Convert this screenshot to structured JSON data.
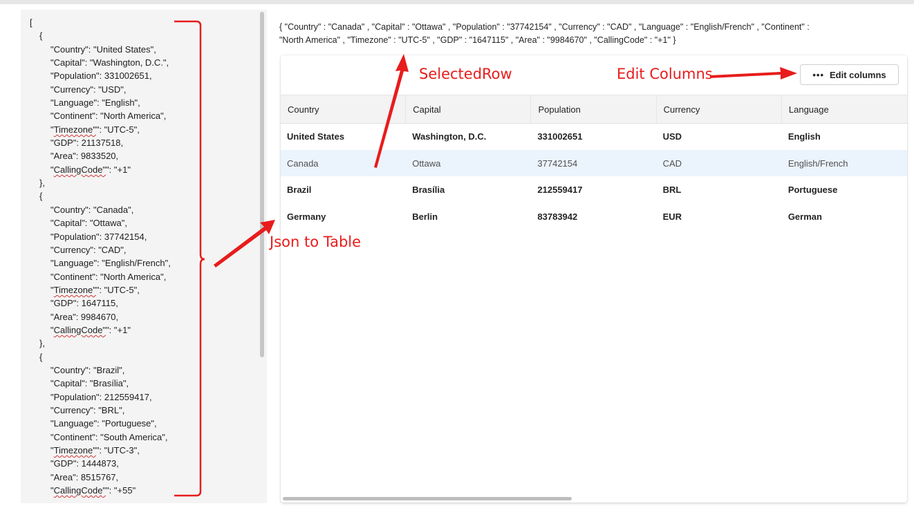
{
  "json_editor": {
    "lines": [
      "[",
      "{",
      "\"Country\": \"United States\",",
      "\"Capital\": \"Washington, D.C.\",",
      "\"Population\": 331002651,",
      "\"Currency\": \"USD\",",
      "\"Language\": \"English\",",
      "\"Continent\": \"North America\",",
      "\"Timezone\": \"UTC-5\",",
      "\"GDP\": 21137518,",
      "\"Area\": 9833520,",
      "\"CallingCode\": \"+1\"",
      "},",
      "{",
      "\"Country\": \"Canada\",",
      "\"Capital\": \"Ottawa\",",
      "\"Population\": 37742154,",
      "\"Currency\": \"CAD\",",
      "\"Language\": \"English/French\",",
      "\"Continent\": \"North America\",",
      "\"Timezone\": \"UTC-5\",",
      "\"GDP\": 1647115,",
      "\"Area\": 9984670,",
      "\"CallingCode\": \"+1\"",
      "},",
      "{",
      "\"Country\": \"Brazil\",",
      "\"Capital\": \"Brasília\",",
      "\"Population\": 212559417,",
      "\"Currency\": \"BRL\",",
      "\"Language\": \"Portuguese\",",
      "\"Continent\": \"South America\",",
      "\"Timezone\": \"UTC-3\",",
      "\"GDP\": 1444873,",
      "\"Area\": 8515767,",
      "\"CallingCode\": \"+55\""
    ]
  },
  "selected_row_text": "{  \"Country\" : \"Canada\" , \"Capital\" : \"Ottawa\" , \"Population\" : \"37742154\" , \"Currency\" : \"CAD\" , \"Language\" : \"English/French\" , \"Continent\" : \"North America\" , \"Timezone\" : \"UTC-5\" , \"GDP\" : \"1647115\" , \"Area\" : \"9984670\" , \"CallingCode\" : \"+1\"  }",
  "toolbar": {
    "edit_columns_label": "Edit columns"
  },
  "table": {
    "headers": [
      "Country",
      "Capital",
      "Population",
      "Currency",
      "Language"
    ],
    "rows": [
      [
        "United States",
        "Washington, D.C.",
        "331002651",
        "USD",
        "English"
      ],
      [
        "Canada",
        "Ottawa",
        "37742154",
        "CAD",
        "English/French"
      ],
      [
        "Brazil",
        "Brasília",
        "212559417",
        "BRL",
        "Portuguese"
      ],
      [
        "Germany",
        "Berlin",
        "83783942",
        "EUR",
        "German"
      ]
    ],
    "selected_row": 1
  },
  "annotations": {
    "selected_row": "SelectedRow",
    "edit_columns": "Edit Columns",
    "json_to_table": "Json to Table",
    "color": "#e81c1c"
  }
}
